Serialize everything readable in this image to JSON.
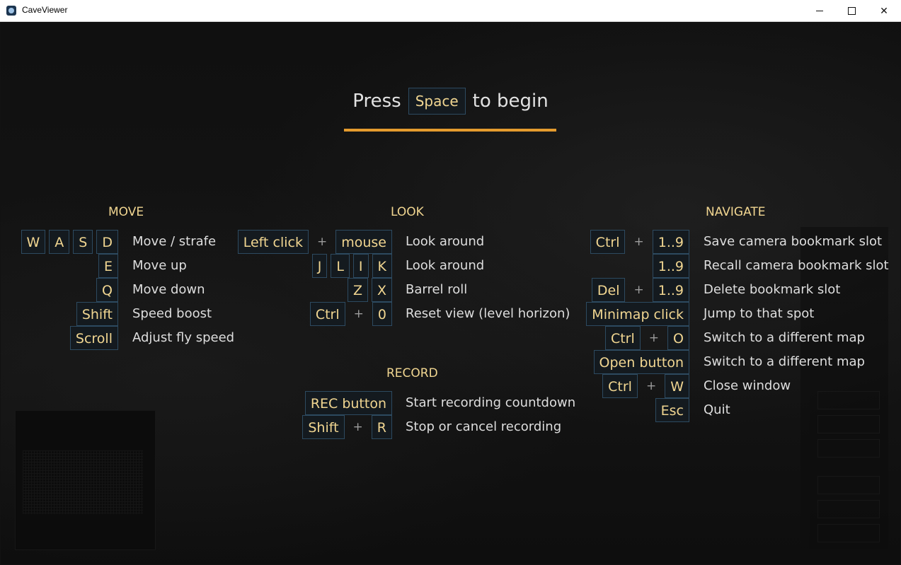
{
  "window": {
    "title": "CaveViewer"
  },
  "intro": {
    "press": "Press",
    "key": "Space",
    "suffix": "to begin"
  },
  "sections": {
    "move": {
      "title": "MOVE"
    },
    "look": {
      "title": "LOOK"
    },
    "record": {
      "title": "RECORD"
    },
    "navigate": {
      "title": "NAVIGATE"
    }
  },
  "plus": "+",
  "move": [
    {
      "keys": [
        "W",
        "A",
        "S",
        "D"
      ],
      "desc": "Move / strafe"
    },
    {
      "keys": [
        "E"
      ],
      "desc": "Move up"
    },
    {
      "keys": [
        "Q"
      ],
      "desc": "Move down"
    },
    {
      "keys": [
        "Shift"
      ],
      "desc": "Speed boost"
    },
    {
      "keys": [
        "Scroll"
      ],
      "desc": "Adjust fly speed"
    }
  ],
  "look": [
    {
      "keys": [
        "Left click",
        "mouse"
      ],
      "desc": "Look around"
    },
    {
      "keys": [
        "J",
        "L",
        "I",
        "K"
      ],
      "desc": "Look around"
    },
    {
      "keys": [
        "Z",
        "X"
      ],
      "desc": "Barrel roll"
    },
    {
      "keys": [
        "Ctrl",
        "0"
      ],
      "desc": "Reset view (level horizon)"
    }
  ],
  "record": [
    {
      "keys": [
        "REC button"
      ],
      "desc": "Start recording countdown"
    },
    {
      "keys": [
        "Shift",
        "R"
      ],
      "desc": "Stop or cancel recording"
    }
  ],
  "navigate": [
    {
      "keys": [
        "Ctrl",
        "1..9"
      ],
      "desc": "Save camera bookmark slot"
    },
    {
      "keys": [
        "1..9"
      ],
      "desc": "Recall camera bookmark slot"
    },
    {
      "keys": [
        "Del",
        "1..9"
      ],
      "desc": "Delete bookmark slot"
    },
    {
      "keys": [
        "Minimap click"
      ],
      "desc": "Jump to that spot"
    },
    {
      "keys": [
        "Ctrl",
        "O"
      ],
      "desc": "Switch to a different map"
    },
    {
      "keys": [
        "Open button"
      ],
      "desc": "Switch to a different map"
    },
    {
      "keys": [
        "Ctrl",
        "W"
      ],
      "desc": "Close window"
    },
    {
      "keys": [
        "Esc"
      ],
      "desc": "Quit"
    }
  ],
  "colors": {
    "accent": "#e49b2e",
    "key_text": "#f1d691",
    "key_border": "#2d4a60"
  }
}
